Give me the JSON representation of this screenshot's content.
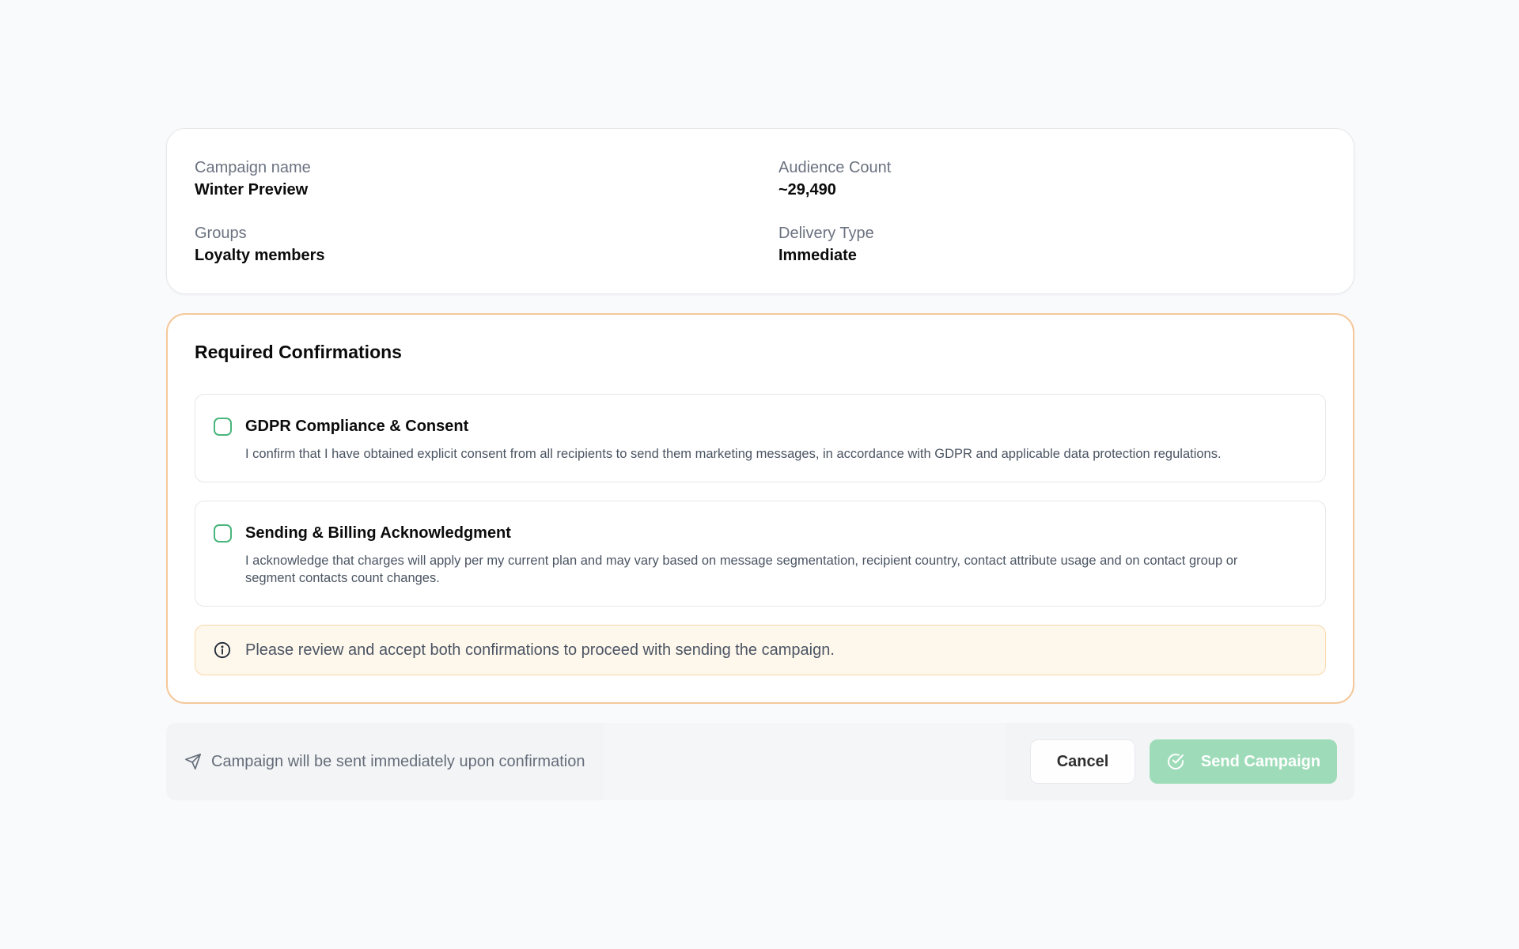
{
  "summary": {
    "campaign_name_label": "Campaign name",
    "campaign_name_value": "Winter Preview",
    "audience_count_label": "Audience Count",
    "audience_count_value": "~29,490",
    "groups_label": "Groups",
    "groups_value": "Loyalty members",
    "delivery_type_label": "Delivery Type",
    "delivery_type_value": "Immediate"
  },
  "confirmations": {
    "title": "Required Confirmations",
    "items": [
      {
        "title": "GDPR Compliance & Consent",
        "description": "I confirm that I have obtained explicit consent from all recipients to send them marketing messages, in accordance with GDPR and applicable data protection regulations.",
        "checked": false
      },
      {
        "title": "Sending & Billing Acknowledgment",
        "description": "I acknowledge that charges will apply per my current plan and may vary based on message segmentation, recipient country, contact attribute usage and on contact group or segment contacts count changes.",
        "checked": false
      }
    ],
    "notice": "Please review and accept both confirmations to proceed with sending the campaign.",
    "notice_icon": "info-icon"
  },
  "footer": {
    "status_text": "Campaign will be sent immediately upon confirmation",
    "status_icon": "send-icon",
    "cancel_label": "Cancel",
    "send_label": "Send Campaign",
    "send_icon": "check-circle-icon"
  },
  "colors": {
    "accent_green": "#8fd7ae",
    "checkbox_border": "#4ab57c",
    "warning_border": "#f5c89a",
    "notice_bg": "#fef7ec"
  }
}
